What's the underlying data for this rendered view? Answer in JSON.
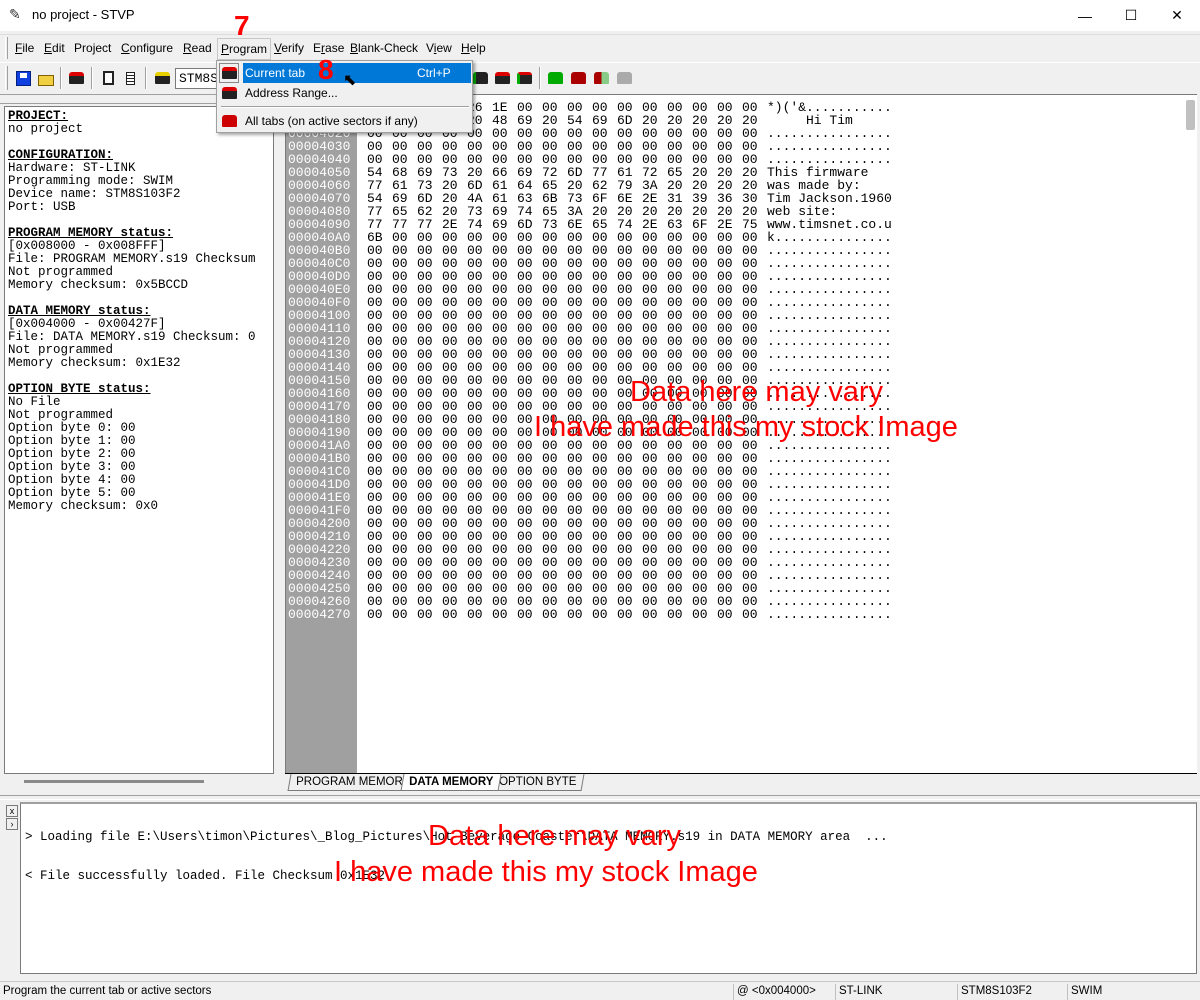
{
  "window": {
    "title": "no project - STVP",
    "minimize": "—",
    "maximize": "☐",
    "close": "✕"
  },
  "menu": [
    {
      "label": "File",
      "u": "F",
      "rest": "ile"
    },
    {
      "label": "Edit",
      "u": "E",
      "rest": "dit"
    },
    {
      "label": "Project",
      "pre": "Pro",
      "u": "j",
      "rest": "ect"
    },
    {
      "label": "Configure",
      "u": "C",
      "rest": "onfigure"
    },
    {
      "label": "Read",
      "u": "R",
      "rest": "ead"
    },
    {
      "label": "Program",
      "u": "P",
      "rest": "rogram"
    },
    {
      "label": "Verify",
      "u": "V",
      "rest": "erify"
    },
    {
      "label": "Erase",
      "pre": "E",
      "u": "r",
      "rest": "ase"
    },
    {
      "label": "Blank-Check",
      "u": "B",
      "rest": "lank-Check"
    },
    {
      "label": "View",
      "pre": "V",
      "u": "i",
      "rest": "ew"
    },
    {
      "label": "Help",
      "u": "H",
      "rest": "elp"
    }
  ],
  "toolbar": {
    "device_combo": "STM8S103F2"
  },
  "dropdown": {
    "items": [
      {
        "label": "Current tab",
        "shortcut": "Ctrl+P",
        "highlighted": true
      },
      {
        "label": "Address Range...",
        "shortcut": ""
      },
      {
        "label": "All tabs (on active sectors if any)",
        "shortcut": ""
      }
    ]
  },
  "left_panel": {
    "lines": [
      {
        "t": "PROJECT:",
        "h": true
      },
      {
        "t": "no project"
      },
      {
        "t": ""
      },
      {
        "t": "CONFIGURATION:",
        "h": true
      },
      {
        "t": "Hardware: ST-LINK"
      },
      {
        "t": "Programming mode: SWIM"
      },
      {
        "t": "Device name: STM8S103F2"
      },
      {
        "t": "Port: USB"
      },
      {
        "t": ""
      },
      {
        "t": "PROGRAM MEMORY status:",
        "h": true
      },
      {
        "t": "[0x008000 - 0x008FFF]"
      },
      {
        "t": "File: PROGRAM MEMORY.s19 Checksum"
      },
      {
        "t": "Not programmed"
      },
      {
        "t": "Memory checksum: 0x5BCCD"
      },
      {
        "t": ""
      },
      {
        "t": "DATA MEMORY status:",
        "h": true
      },
      {
        "t": "[0x004000 - 0x00427F]"
      },
      {
        "t": "File: DATA MEMORY.s19 Checksum: 0"
      },
      {
        "t": "Not programmed"
      },
      {
        "t": "Memory checksum: 0x1E32"
      },
      {
        "t": ""
      },
      {
        "t": "OPTION BYTE status:",
        "h": true
      },
      {
        "t": "No File"
      },
      {
        "t": "Not programmed"
      },
      {
        "t": "Option byte 0: 00"
      },
      {
        "t": "Option byte 1: 00"
      },
      {
        "t": "Option byte 2: 00"
      },
      {
        "t": "Option byte 3: 00"
      },
      {
        "t": "Option byte 4: 00"
      },
      {
        "t": "Option byte 5: 00"
      },
      {
        "t": "Memory checksum: 0x0"
      }
    ]
  },
  "hex_rows": [
    {
      "addr": "00004000",
      "hex": "2A 29 28 27 26 1E 00 00 00 00 00 00 00 00 00 00",
      "ascii": "*)('&..........."
    },
    {
      "addr": "00004010",
      "hex": "20 20 20 20 20 48 69 20 54 69 6D 20 20 20 20 20",
      "ascii": "     Hi Tim     "
    },
    {
      "addr": "00004020",
      "hex": "00 00 00 00 00 00 00 00 00 00 00 00 00 00 00 00",
      "ascii": "................"
    },
    {
      "addr": "00004030",
      "hex": "00 00 00 00 00 00 00 00 00 00 00 00 00 00 00 00",
      "ascii": "................"
    },
    {
      "addr": "00004040",
      "hex": "00 00 00 00 00 00 00 00 00 00 00 00 00 00 00 00",
      "ascii": "................"
    },
    {
      "addr": "00004050",
      "hex": "54 68 69 73 20 66 69 72 6D 77 61 72 65 20 20 20",
      "ascii": "This firmware   "
    },
    {
      "addr": "00004060",
      "hex": "77 61 73 20 6D 61 64 65 20 62 79 3A 20 20 20 20",
      "ascii": "was made by:    "
    },
    {
      "addr": "00004070",
      "hex": "54 69 6D 20 4A 61 63 6B 73 6F 6E 2E 31 39 36 30",
      "ascii": "Tim Jackson.1960"
    },
    {
      "addr": "00004080",
      "hex": "77 65 62 20 73 69 74 65 3A 20 20 20 20 20 20 20",
      "ascii": "web site:       "
    },
    {
      "addr": "00004090",
      "hex": "77 77 77 2E 74 69 6D 73 6E 65 74 2E 63 6F 2E 75",
      "ascii": "www.timsnet.co.u"
    },
    {
      "addr": "000040A0",
      "hex": "6B 00 00 00 00 00 00 00 00 00 00 00 00 00 00 00",
      "ascii": "k..............."
    },
    {
      "addr": "000040B0",
      "hex": "00 00 00 00 00 00 00 00 00 00 00 00 00 00 00 00",
      "ascii": "................"
    },
    {
      "addr": "000040C0",
      "hex": "00 00 00 00 00 00 00 00 00 00 00 00 00 00 00 00",
      "ascii": "................"
    },
    {
      "addr": "000040D0",
      "hex": "00 00 00 00 00 00 00 00 00 00 00 00 00 00 00 00",
      "ascii": "................"
    },
    {
      "addr": "000040E0",
      "hex": "00 00 00 00 00 00 00 00 00 00 00 00 00 00 00 00",
      "ascii": "................"
    },
    {
      "addr": "000040F0",
      "hex": "00 00 00 00 00 00 00 00 00 00 00 00 00 00 00 00",
      "ascii": "................"
    },
    {
      "addr": "00004100",
      "hex": "00 00 00 00 00 00 00 00 00 00 00 00 00 00 00 00",
      "ascii": "................"
    },
    {
      "addr": "00004110",
      "hex": "00 00 00 00 00 00 00 00 00 00 00 00 00 00 00 00",
      "ascii": "................"
    },
    {
      "addr": "00004120",
      "hex": "00 00 00 00 00 00 00 00 00 00 00 00 00 00 00 00",
      "ascii": "................"
    },
    {
      "addr": "00004130",
      "hex": "00 00 00 00 00 00 00 00 00 00 00 00 00 00 00 00",
      "ascii": "................"
    },
    {
      "addr": "00004140",
      "hex": "00 00 00 00 00 00 00 00 00 00 00 00 00 00 00 00",
      "ascii": "................"
    },
    {
      "addr": "00004150",
      "hex": "00 00 00 00 00 00 00 00 00 00 00 00 00 00 00 00",
      "ascii": "................"
    },
    {
      "addr": "00004160",
      "hex": "00 00 00 00 00 00 00 00 00 00 00 00 00 00 00 00",
      "ascii": "................"
    },
    {
      "addr": "00004170",
      "hex": "00 00 00 00 00 00 00 00 00 00 00 00 00 00 00 00",
      "ascii": "................"
    },
    {
      "addr": "00004180",
      "hex": "00 00 00 00 00 00 00 00 00 00 00 00 00 00 00 00",
      "ascii": "................"
    },
    {
      "addr": "00004190",
      "hex": "00 00 00 00 00 00 00 00 00 00 00 00 00 00 00 00",
      "ascii": "................"
    },
    {
      "addr": "000041A0",
      "hex": "00 00 00 00 00 00 00 00 00 00 00 00 00 00 00 00",
      "ascii": "................"
    },
    {
      "addr": "000041B0",
      "hex": "00 00 00 00 00 00 00 00 00 00 00 00 00 00 00 00",
      "ascii": "................"
    },
    {
      "addr": "000041C0",
      "hex": "00 00 00 00 00 00 00 00 00 00 00 00 00 00 00 00",
      "ascii": "................"
    },
    {
      "addr": "000041D0",
      "hex": "00 00 00 00 00 00 00 00 00 00 00 00 00 00 00 00",
      "ascii": "................"
    },
    {
      "addr": "000041E0",
      "hex": "00 00 00 00 00 00 00 00 00 00 00 00 00 00 00 00",
      "ascii": "................"
    },
    {
      "addr": "000041F0",
      "hex": "00 00 00 00 00 00 00 00 00 00 00 00 00 00 00 00",
      "ascii": "................"
    },
    {
      "addr": "00004200",
      "hex": "00 00 00 00 00 00 00 00 00 00 00 00 00 00 00 00",
      "ascii": "................"
    },
    {
      "addr": "00004210",
      "hex": "00 00 00 00 00 00 00 00 00 00 00 00 00 00 00 00",
      "ascii": "................"
    },
    {
      "addr": "00004220",
      "hex": "00 00 00 00 00 00 00 00 00 00 00 00 00 00 00 00",
      "ascii": "................"
    },
    {
      "addr": "00004230",
      "hex": "00 00 00 00 00 00 00 00 00 00 00 00 00 00 00 00",
      "ascii": "................"
    },
    {
      "addr": "00004240",
      "hex": "00 00 00 00 00 00 00 00 00 00 00 00 00 00 00 00",
      "ascii": "................"
    },
    {
      "addr": "00004250",
      "hex": "00 00 00 00 00 00 00 00 00 00 00 00 00 00 00 00",
      "ascii": "................"
    },
    {
      "addr": "00004260",
      "hex": "00 00 00 00 00 00 00 00 00 00 00 00 00 00 00 00",
      "ascii": "................"
    },
    {
      "addr": "00004270",
      "hex": "00 00 00 00 00 00 00 00 00 00 00 00 00 00 00 00",
      "ascii": "................"
    }
  ],
  "tabs": [
    {
      "label": "PROGRAM MEMORY"
    },
    {
      "label": "DATA MEMORY",
      "active": true
    },
    {
      "label": "OPTION BYTE"
    }
  ],
  "log": {
    "close_btn": "x",
    "arrow_btn": "›",
    "lines": [
      "> Loading file E:\\Users\\timon\\Pictures\\_Blog_Pictures\\Hot Beverage Coaster\\DATA MEMORY.s19 in DATA MEMORY area  ...",
      "< File successfully loaded. File Checksum 0x1E32"
    ]
  },
  "status": {
    "message": "Program the current tab or active sectors",
    "address": "@ <0x004000>",
    "hardware": "ST-LINK",
    "device": "STM8S103F2",
    "mode": "SWIM"
  },
  "annotations": {
    "step7": "7",
    "step8": "8",
    "note1": "Data here may vary",
    "note2": "I have made this my stock Image",
    "color": "#ff0000"
  },
  "colors": {
    "highlight": "#0078d7",
    "address_column": "#a0a0a0",
    "chip_red": "#c00000",
    "chip_green": "#008000"
  }
}
